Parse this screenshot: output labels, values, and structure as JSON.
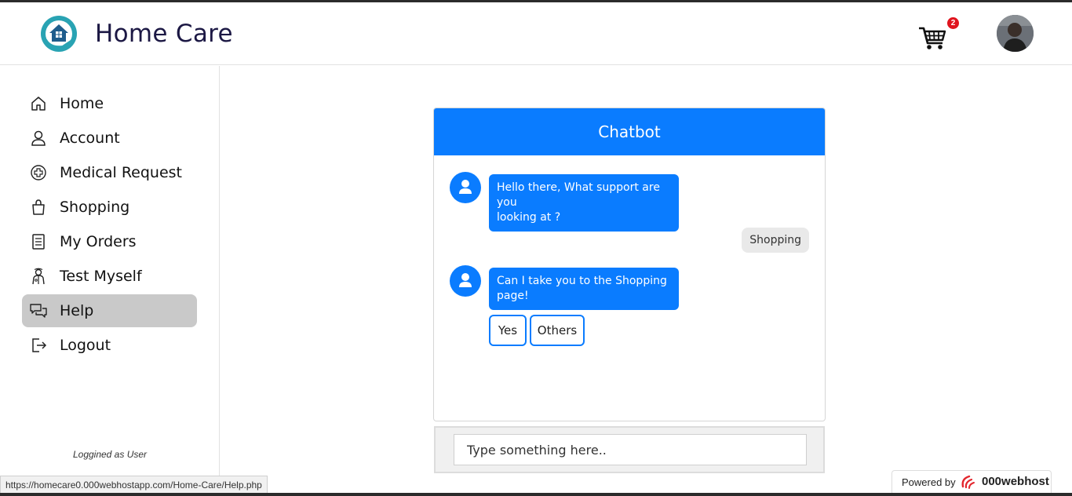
{
  "header": {
    "title": "Home Care",
    "cart_count": "2"
  },
  "sidebar": {
    "items": [
      {
        "label": "Home",
        "icon": "home-icon"
      },
      {
        "label": "Account",
        "icon": "user-icon"
      },
      {
        "label": "Medical Request",
        "icon": "medical-cross-icon"
      },
      {
        "label": "Shopping",
        "icon": "shopping-bag-icon"
      },
      {
        "label": "My Orders",
        "icon": "receipt-icon"
      },
      {
        "label": "Test Myself",
        "icon": "doctor-icon"
      },
      {
        "label": "Help",
        "icon": "chat-bubbles-icon",
        "active": true
      },
      {
        "label": "Logout",
        "icon": "logout-icon"
      }
    ],
    "logged_as": "Loggined as User"
  },
  "chat": {
    "title": "Chatbot",
    "messages": [
      {
        "from": "bot",
        "text_line1": "Hello there, What support are you",
        "text_line2": "looking at ?"
      },
      {
        "from": "user",
        "text": "Shopping"
      },
      {
        "from": "bot",
        "text_line1": "Can I take you to the Shopping",
        "text_line2": "page!"
      }
    ],
    "options": [
      "Yes",
      "Others"
    ],
    "input_placeholder": "Type something here.."
  },
  "status_bar": {
    "url": "https://homecare0.000webhostapp.com/Home-Care/Help.php"
  },
  "powered_by": {
    "label": "Powered by",
    "brand": "000webhost"
  },
  "colors": {
    "accent": "#0a7cff",
    "title": "#1c1844",
    "active_nav": "#c9c9c9",
    "badge": "#e0141e"
  }
}
